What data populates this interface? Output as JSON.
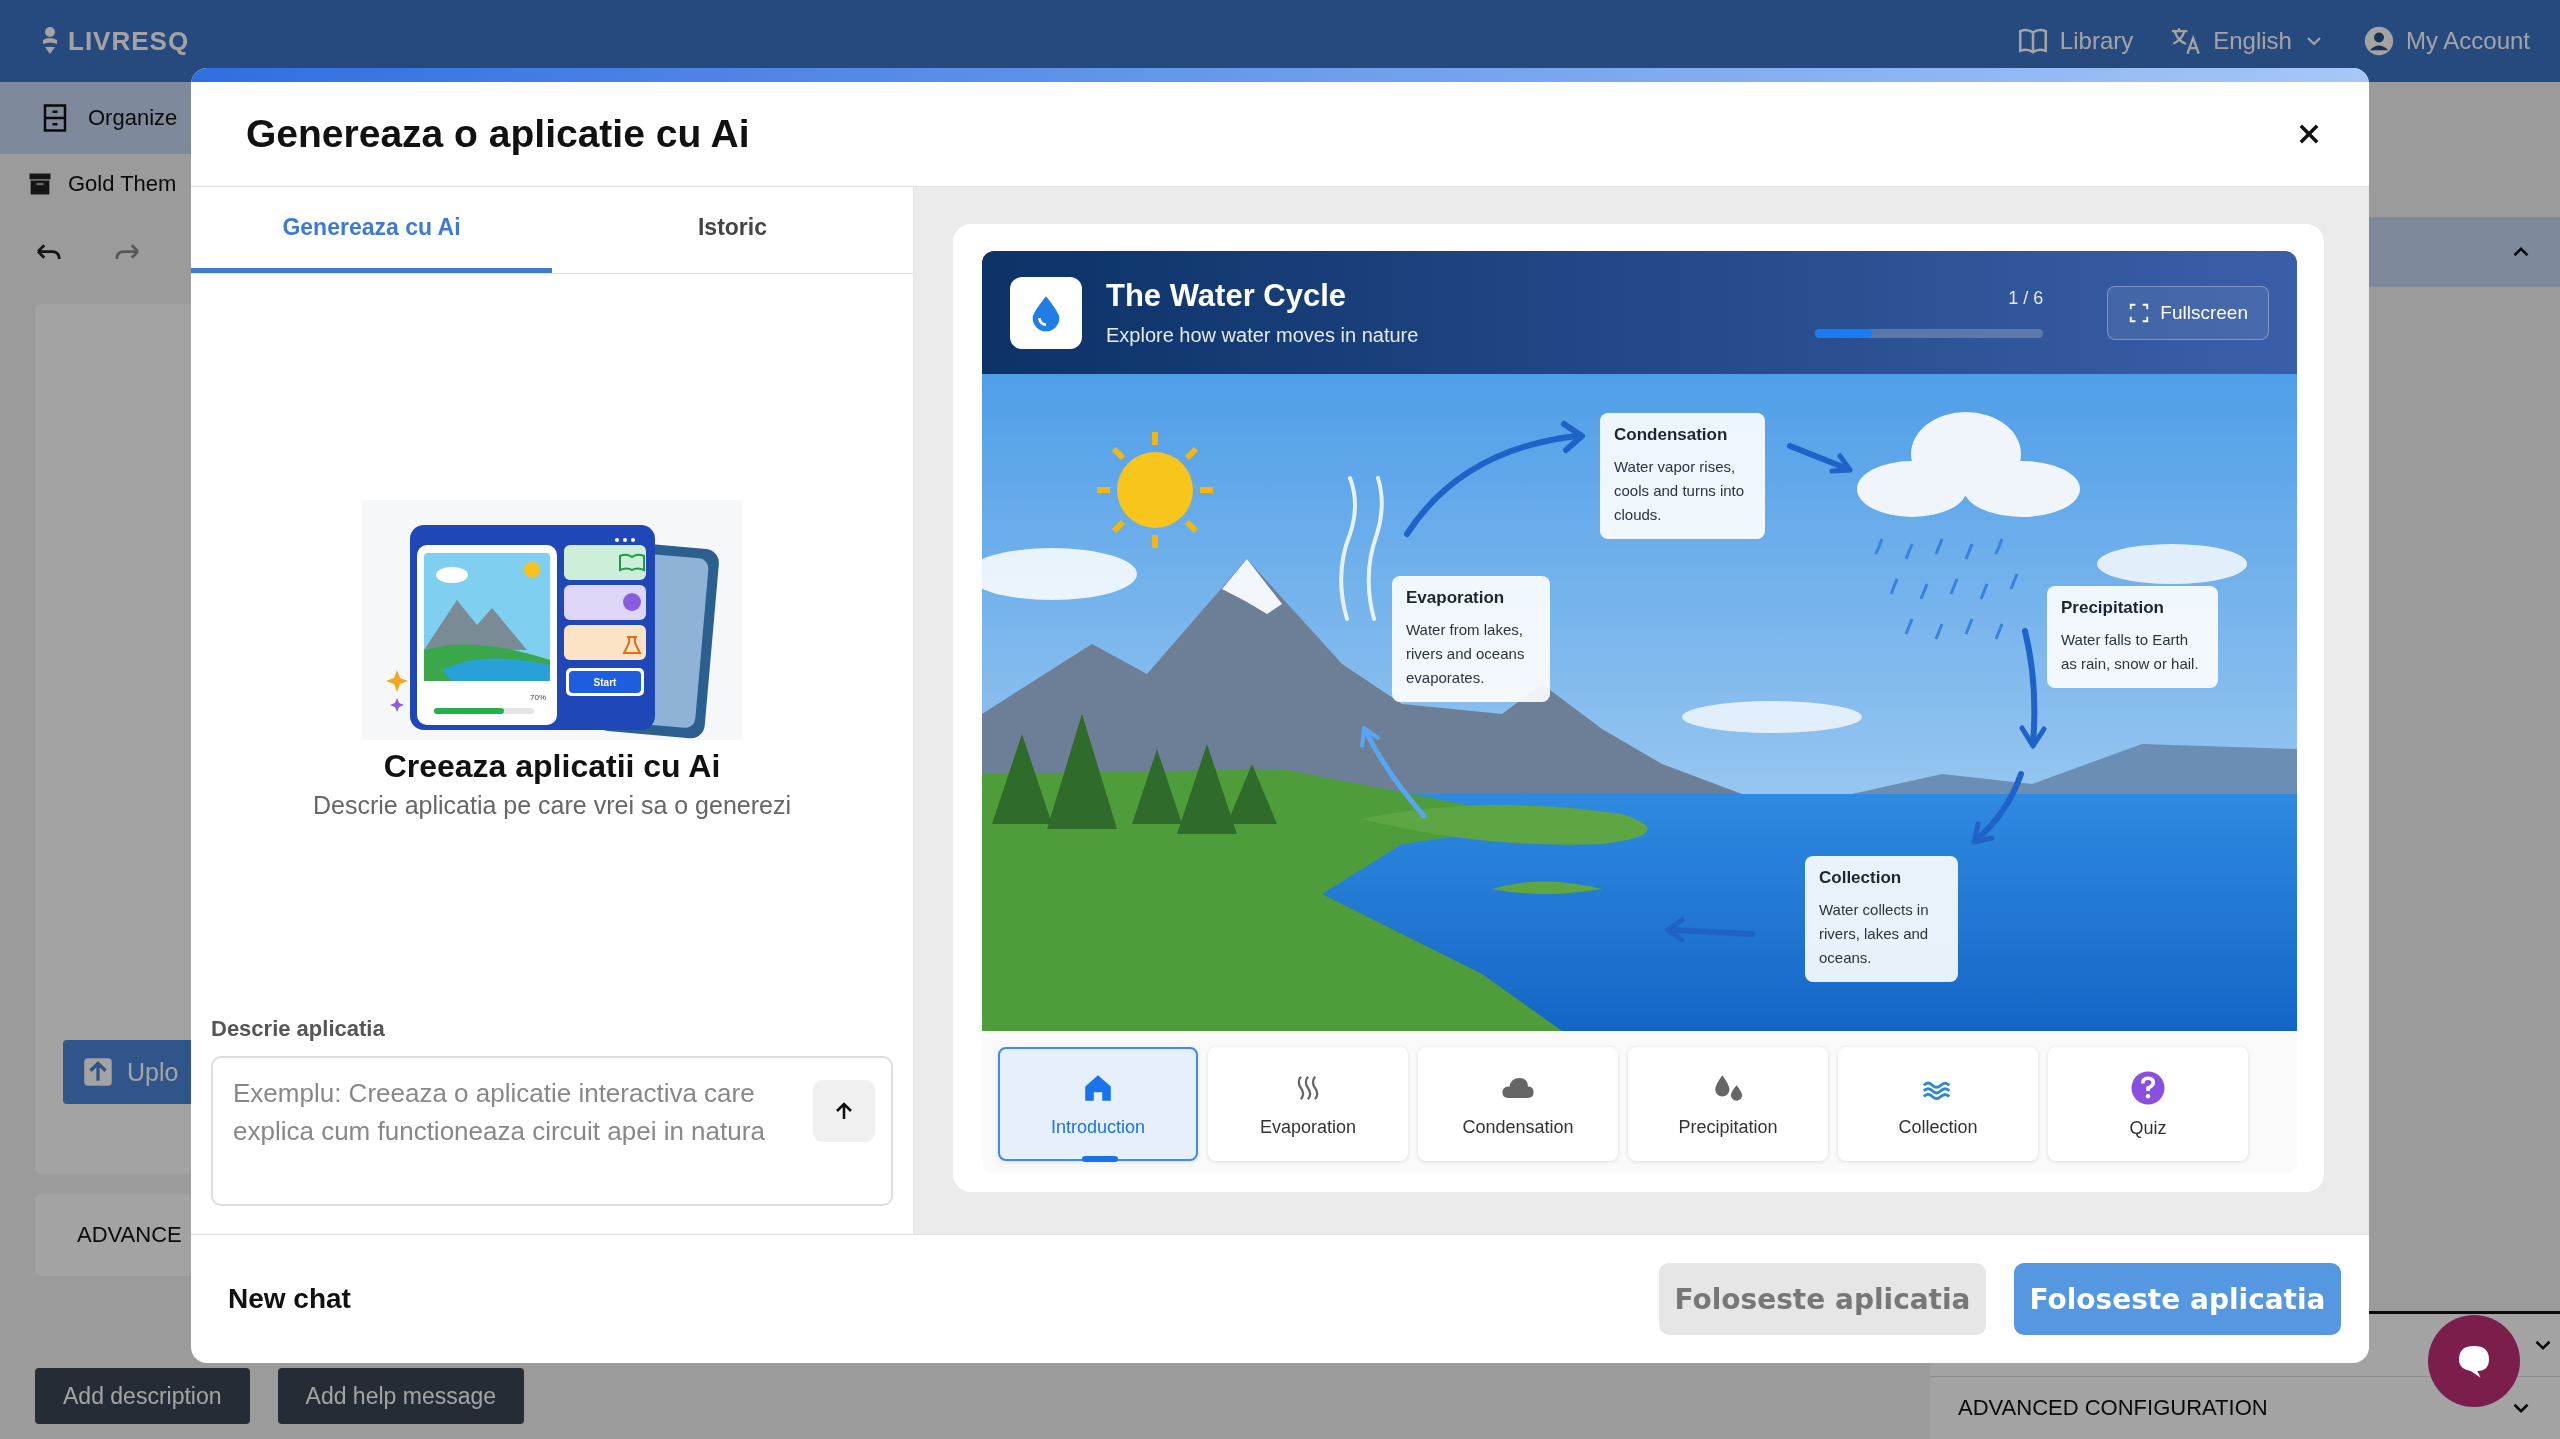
{
  "app_bar": {
    "logo": "LIVRESQ",
    "library": "Library",
    "language": "English",
    "account": "My Account"
  },
  "background": {
    "toolbar_label": "Organize",
    "theme_label": "Gold Them",
    "upload_button": "Uplo",
    "advanced_label": "ADVANCE",
    "buttons": [
      "Add description",
      "Add help message"
    ],
    "advanced_configuration": "ADVANCED CONFIGURATION"
  },
  "dialog": {
    "title": "Genereaza o aplicatie cu Ai",
    "tabs": [
      {
        "label": "Genereaza cu Ai",
        "selected": true
      },
      {
        "label": "Istoric",
        "selected": false
      }
    ],
    "illustration": {
      "percent": "70%",
      "button": "Start"
    },
    "empty_state": {
      "title": "Creeaza aplicatii cu Ai",
      "subtitle": "Descrie aplicatia pe care vrei sa o generezi"
    },
    "prompt": {
      "label": "Descrie aplicatia",
      "placeholder": "Exemplu: Creeaza o aplicatie interactiva care explica cum functioneaza circuit apei in natura"
    },
    "new_chat": "New chat",
    "buttons": [
      {
        "label": "Foloseste aplicatia",
        "disabled": true
      },
      {
        "label": "Foloseste aplicatia",
        "disabled": false
      }
    ]
  },
  "preview": {
    "title": "The Water Cycle",
    "subtitle": "Explore how water moves in nature",
    "step": "1 / 6",
    "progress": {
      "level": 0.25
    },
    "fullscreen": "Fullscreen",
    "labels": [
      {
        "title": "Condensation",
        "text": "Water vapor rises, cools and turns into clouds."
      },
      {
        "title": "Evaporation",
        "text": "Water from lakes, rivers and oceans evaporates."
      },
      {
        "title": "Precipitation",
        "text": "Water falls to Earth as rain, snow or hail."
      },
      {
        "title": "Collection",
        "text": "Water collects in rivers, lakes and oceans."
      }
    ],
    "nav": [
      {
        "label": "Introduction",
        "kind": "home",
        "selected": true
      },
      {
        "label": "Evaporation",
        "kind": "steam",
        "selected": false
      },
      {
        "label": "Condensation",
        "kind": "cloud",
        "selected": false
      },
      {
        "label": "Precipitation",
        "kind": "drops",
        "selected": false
      },
      {
        "label": "Collection",
        "kind": "waves",
        "selected": false
      },
      {
        "label": "Quiz",
        "kind": "question",
        "selected": false
      }
    ]
  }
}
